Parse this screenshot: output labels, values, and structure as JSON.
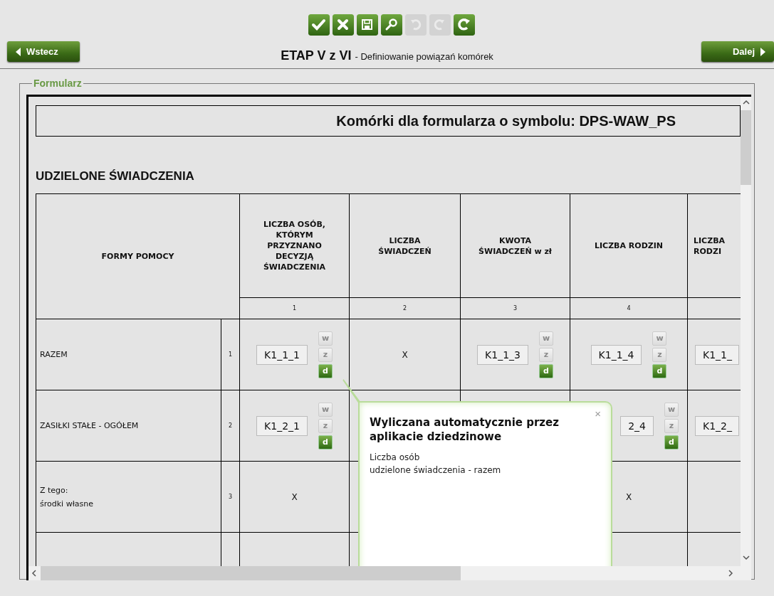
{
  "toolbar": [
    {
      "kind": "accept",
      "disabled": false
    },
    {
      "kind": "cancel",
      "disabled": false
    },
    {
      "kind": "save",
      "disabled": false
    },
    {
      "kind": "search",
      "disabled": false
    },
    {
      "kind": "undo",
      "disabled": true
    },
    {
      "kind": "redo",
      "disabled": true
    },
    {
      "kind": "refresh",
      "disabled": false
    }
  ],
  "nav": {
    "back": "Wstecz",
    "next": "Dalej",
    "stage": "ETAP V z VI",
    "subtitle": "- Definiowanie powiązań komórek"
  },
  "form": {
    "legend": "Formularz",
    "heading": "Komórki dla formularza o symbolu: DPS-WAW_PS",
    "section": "UDZIELONE ŚWIADCZENIA",
    "table": {
      "corner": "FORMY POMOCY",
      "columns": [
        {
          "label": [
            "LICZBA OSÓB,",
            "KTÓRYM",
            "PRZYZNANO",
            "DECYZJĄ",
            "ŚWIADCZENIA"
          ],
          "number": "1"
        },
        {
          "label": [
            "LICZBA",
            "ŚWIADCZEŃ"
          ],
          "number": "2"
        },
        {
          "label": [
            "KWOTA",
            "ŚWIADCZEŃ w zł"
          ],
          "number": "3"
        },
        {
          "label": [
            "LICZBA RODZIN"
          ],
          "number": "4"
        },
        {
          "label": [
            "LICZBA",
            "RODZI"
          ]
        }
      ],
      "rows": [
        {
          "label": [
            "RAZEM"
          ],
          "number": "1",
          "cells": [
            {
              "kind": "field",
              "value": "K1_1_1",
              "buttons": [
                {
                  "label": "w",
                  "disabled": true
                },
                {
                  "label": "z",
                  "disabled": true
                },
                {
                  "label": "d",
                  "disabled": false
                }
              ]
            },
            {
              "kind": "text",
              "value": "X"
            },
            {
              "kind": "field",
              "value": "K1_1_3",
              "buttons": [
                {
                  "label": "w",
                  "disabled": true
                },
                {
                  "label": "z",
                  "disabled": true
                },
                {
                  "label": "d",
                  "disabled": false
                }
              ]
            },
            {
              "kind": "field",
              "value": "K1_1_4",
              "buttons": [
                {
                  "label": "w",
                  "disabled": true
                },
                {
                  "label": "z",
                  "disabled": true
                },
                {
                  "label": "d",
                  "disabled": false
                }
              ]
            },
            {
              "kind": "field",
              "value": "K1_1_"
            }
          ]
        },
        {
          "label": [
            "ZASIŁKI STAŁE - OGÓŁEM"
          ],
          "number": "2",
          "cells": [
            {
              "kind": "field",
              "value": "K1_2_1",
              "buttons": [
                {
                  "label": "w",
                  "disabled": true
                },
                {
                  "label": "z",
                  "disabled": true
                },
                {
                  "label": "d",
                  "disabled": false
                }
              ]
            },
            {
              "kind": "empty"
            },
            {
              "kind": "empty"
            },
            {
              "kind": "field",
              "value": "2_4",
              "buttons": [
                {
                  "label": "w",
                  "disabled": true
                },
                {
                  "label": "z",
                  "disabled": true
                },
                {
                  "label": "d",
                  "disabled": false
                }
              ]
            },
            {
              "kind": "field",
              "value": "K1_2_"
            }
          ]
        },
        {
          "label": [
            "Z tego:",
            "środki własne"
          ],
          "number": "3",
          "cells": [
            {
              "kind": "text",
              "value": "X"
            },
            {
              "kind": "empty"
            },
            {
              "kind": "empty"
            },
            {
              "kind": "text",
              "value": "X"
            },
            {
              "kind": "empty"
            }
          ]
        },
        {
          "label": [],
          "cells": [
            {
              "kind": "empty"
            },
            {
              "kind": "empty"
            },
            {
              "kind": "empty"
            },
            {
              "kind": "empty"
            },
            {
              "kind": "empty"
            }
          ]
        }
      ]
    },
    "popover": {
      "title": "Wyliczana automatycznie przez aplikacie dziedzinowe",
      "close": "×",
      "lines": [
        "Liczba osób",
        "udzielone świadczenia - razem"
      ]
    }
  }
}
